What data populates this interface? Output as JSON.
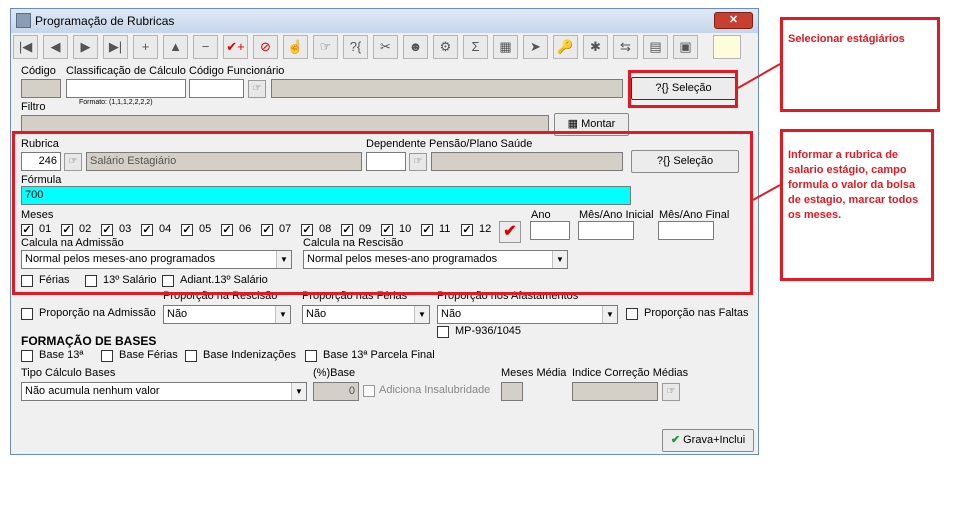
{
  "window": {
    "title": "Programação de Rubricas",
    "close": "✕"
  },
  "toolbar": [
    "|◀",
    "◀",
    "▶",
    "▶|",
    "+",
    "▲",
    "−",
    "✔+",
    "⊘",
    "☝",
    "☞",
    "?{",
    "✂",
    "☻",
    "⚙",
    "Σ",
    "▦",
    "➤",
    "🔑",
    "✱",
    "⇆",
    "▤",
    "▣"
  ],
  "header": {
    "codigo_label": "Código",
    "classificacao_label": "Classificação de Cálculo",
    "formato_label": "Formato: (1,1,1,2,2,2,2)",
    "codigo_func_label": "Código Funcionário",
    "selecao_btn": "?{} Seleção",
    "filtro_label": "Filtro",
    "montar_btn": "Montar"
  },
  "rubrica": {
    "label": "Rubrica",
    "code": "246",
    "name": "Salário Estagiário",
    "dependente_label": "Dependente Pensão/Plano Saúde",
    "selecao_btn": "?{} Seleção",
    "formula_label": "Fórmula",
    "formula_value": "700"
  },
  "meses": {
    "label": "Meses",
    "items": [
      "01",
      "02",
      "03",
      "04",
      "05",
      "06",
      "07",
      "08",
      "09",
      "10",
      "11",
      "12"
    ],
    "ano_label": "Ano",
    "inicial_label": "Mês/Ano Inicial",
    "final_label": "Mês/Ano Final"
  },
  "calcula": {
    "admissao_label": "Calcula na Admissão",
    "admissao_value": "Normal pelos meses-ano programados",
    "rescisao_label": "Calcula na Rescisão",
    "rescisao_value": "Normal pelos meses-ano programados",
    "ferias": "Férias",
    "salario13": "13º Salário",
    "adiant13": "Adiant.13º Salário"
  },
  "proporcao": {
    "admissao": "Proporção na Admissão",
    "rescisao_label": "Proporção na Rescisão",
    "rescisao_value": "Não",
    "ferias_label": "Proporção nas Férias",
    "ferias_value": "Não",
    "afast_label": "Proporção nos Afastamentos",
    "afast_value": "Não",
    "faltas": "Proporção nas Faltas",
    "mp": "MP-936/1045"
  },
  "bases": {
    "title": "FORMAÇÃO DE BASES",
    "base13": "Base 13ª",
    "ferias": "Base Férias",
    "indenizacoes": "Base Indenizações",
    "parcela13": "Base 13ª Parcela Final",
    "tipo_label": "Tipo Cálculo Bases",
    "tipo_value": "Não acumula nenhum valor",
    "pct_label": "(%)Base",
    "pct_value": "0",
    "insalubridade": "Adiciona Insalubridade",
    "meses_media": "Meses Média",
    "indice": "Indice Correção Médias"
  },
  "grava_btn": "Grava+Inclui",
  "annotations": {
    "note1": "Selecionar estágiários",
    "note2": "Informar a rubrica de salario estágio, campo formula o valor da bolsa de estagio, marcar todos os meses."
  },
  "colors": {
    "accent_red": "#e01b24",
    "formula_bg": "#00ffff"
  }
}
